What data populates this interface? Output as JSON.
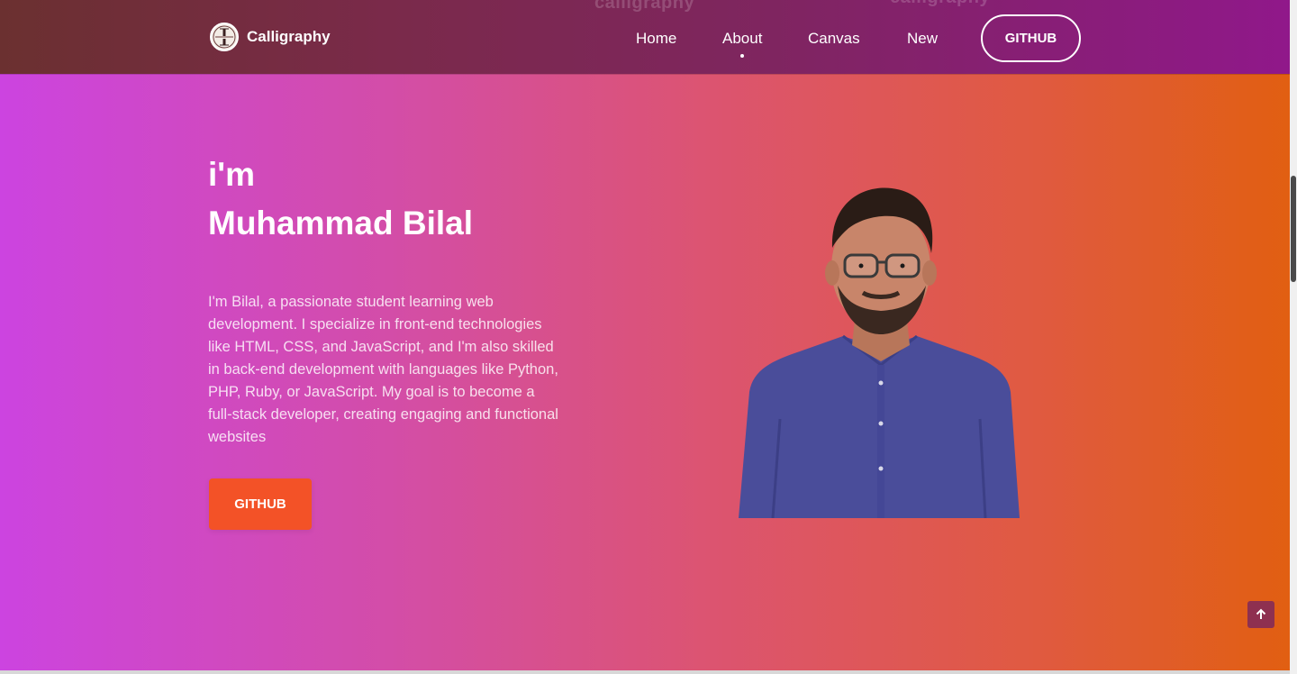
{
  "navbar": {
    "ghost_text_1": "calligraphy",
    "ghost_text_2": "calligraphy",
    "brand": {
      "logo_icon": "calligraphy-logo-icon",
      "name": "Calligraphy"
    },
    "links": [
      {
        "label": "Home",
        "active": false
      },
      {
        "label": "About",
        "active": true
      },
      {
        "label": "Canvas",
        "active": false
      },
      {
        "label": "New",
        "active": false
      }
    ],
    "github_label": "GITHUB"
  },
  "hero": {
    "intro": "i'm",
    "name": "Muhammad Bilal",
    "bio": "I'm Bilal, a passionate student learning web development. I specialize in front-end technologies like HTML, CSS, and JavaScript, and I'm also skilled in back-end development with languages like Python, PHP, Ruby, or JavaScript. My goal is to become a full-stack developer, creating engaging and functional websites",
    "github_label": "GITHUB",
    "portrait": "profile-portrait-image"
  },
  "scroll_top": {
    "icon": "arrow-up-icon"
  },
  "colors": {
    "accent_button": "#f35227",
    "nav_start": "#6b3030",
    "nav_end": "#90188a",
    "bg_start": "#cc44e0",
    "bg_end": "#e15f10",
    "scroll_top_bg": "#8e3050"
  }
}
